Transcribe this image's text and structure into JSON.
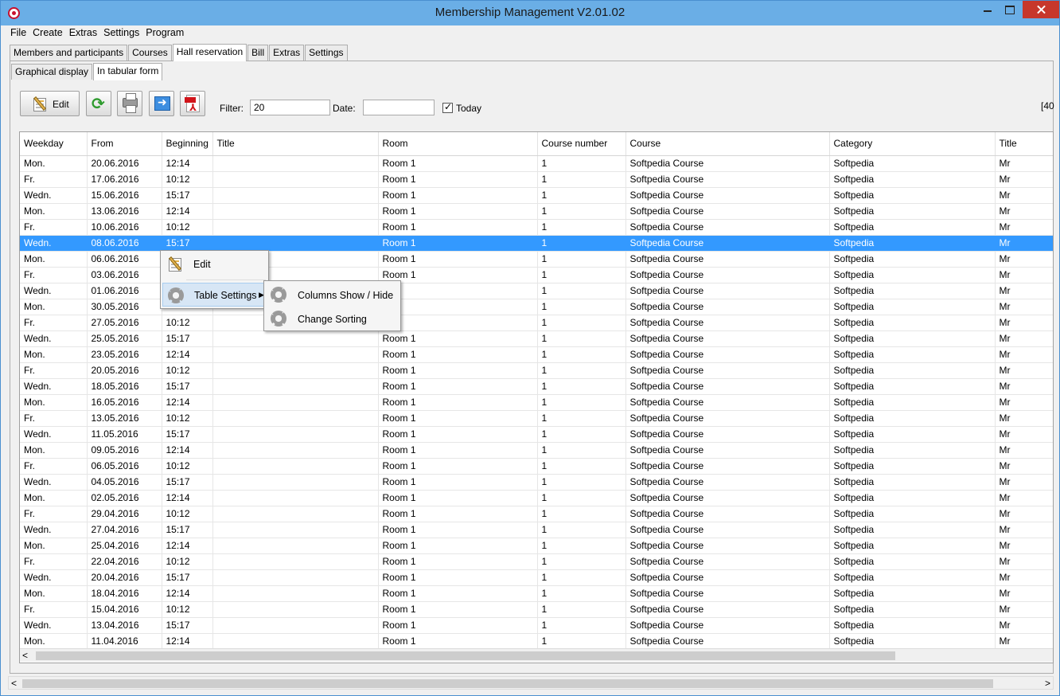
{
  "window": {
    "title": "Membership Management V2.01.02"
  },
  "menu": [
    "File",
    "Create",
    "Extras",
    "Settings",
    "Program"
  ],
  "main_tabs": [
    "Members and participants",
    "Courses",
    "Hall reservation",
    "Bill",
    "Extras",
    "Settings"
  ],
  "main_tabs_active": "Hall reservation",
  "sub_tabs": [
    "Graphical display",
    "In tabular form"
  ],
  "sub_tabs_active": "In tabular form",
  "toolbar": {
    "edit_label": "Edit",
    "filter_label": "Filter:",
    "filter_value": "20",
    "date_label": "Date:",
    "date_value": "",
    "today_label": "Today",
    "today_checked": true,
    "count_text": "[40"
  },
  "icons": [
    "edit-icon",
    "refresh-icon",
    "print-icon",
    "export-icon",
    "pdf-icon"
  ],
  "table": {
    "columns": [
      "Weekday",
      "From",
      "Beginning",
      "Title",
      "Room",
      "Course number",
      "Course",
      "Category",
      "Title"
    ],
    "selected_row": 5,
    "rows": [
      [
        "Mon.",
        "20.06.2016",
        "12:14",
        "",
        "Room 1",
        "1",
        "Softpedia Course",
        "Softpedia",
        "Mr"
      ],
      [
        "Fr.",
        "17.06.2016",
        "10:12",
        "",
        "Room 1",
        "1",
        "Softpedia Course",
        "Softpedia",
        "Mr"
      ],
      [
        "Wedn.",
        "15.06.2016",
        "15:17",
        "",
        "Room 1",
        "1",
        "Softpedia Course",
        "Softpedia",
        "Mr"
      ],
      [
        "Mon.",
        "13.06.2016",
        "12:14",
        "",
        "Room 1",
        "1",
        "Softpedia Course",
        "Softpedia",
        "Mr"
      ],
      [
        "Fr.",
        "10.06.2016",
        "10:12",
        "",
        "Room 1",
        "1",
        "Softpedia Course",
        "Softpedia",
        "Mr"
      ],
      [
        "Wedn.",
        "08.06.2016",
        "15:17",
        "",
        "Room 1",
        "1",
        "Softpedia Course",
        "Softpedia",
        "Mr"
      ],
      [
        "Mon.",
        "06.06.2016",
        "",
        "",
        "Room 1",
        "1",
        "Softpedia Course",
        "Softpedia",
        "Mr"
      ],
      [
        "Fr.",
        "03.06.2016",
        "",
        "",
        "Room 1",
        "1",
        "Softpedia Course",
        "Softpedia",
        "Mr"
      ],
      [
        "Wedn.",
        "01.06.2016",
        "",
        "",
        "",
        "1",
        "Softpedia Course",
        "Softpedia",
        "Mr"
      ],
      [
        "Mon.",
        "30.05.2016",
        "",
        "",
        "",
        "1",
        "Softpedia Course",
        "Softpedia",
        "Mr"
      ],
      [
        "Fr.",
        "27.05.2016",
        "10:12",
        "",
        "",
        "1",
        "Softpedia Course",
        "Softpedia",
        "Mr"
      ],
      [
        "Wedn.",
        "25.05.2016",
        "15:17",
        "",
        "Room 1",
        "1",
        "Softpedia Course",
        "Softpedia",
        "Mr"
      ],
      [
        "Mon.",
        "23.05.2016",
        "12:14",
        "",
        "Room 1",
        "1",
        "Softpedia Course",
        "Softpedia",
        "Mr"
      ],
      [
        "Fr.",
        "20.05.2016",
        "10:12",
        "",
        "Room 1",
        "1",
        "Softpedia Course",
        "Softpedia",
        "Mr"
      ],
      [
        "Wedn.",
        "18.05.2016",
        "15:17",
        "",
        "Room 1",
        "1",
        "Softpedia Course",
        "Softpedia",
        "Mr"
      ],
      [
        "Mon.",
        "16.05.2016",
        "12:14",
        "",
        "Room 1",
        "1",
        "Softpedia Course",
        "Softpedia",
        "Mr"
      ],
      [
        "Fr.",
        "13.05.2016",
        "10:12",
        "",
        "Room 1",
        "1",
        "Softpedia Course",
        "Softpedia",
        "Mr"
      ],
      [
        "Wedn.",
        "11.05.2016",
        "15:17",
        "",
        "Room 1",
        "1",
        "Softpedia Course",
        "Softpedia",
        "Mr"
      ],
      [
        "Mon.",
        "09.05.2016",
        "12:14",
        "",
        "Room 1",
        "1",
        "Softpedia Course",
        "Softpedia",
        "Mr"
      ],
      [
        "Fr.",
        "06.05.2016",
        "10:12",
        "",
        "Room 1",
        "1",
        "Softpedia Course",
        "Softpedia",
        "Mr"
      ],
      [
        "Wedn.",
        "04.05.2016",
        "15:17",
        "",
        "Room 1",
        "1",
        "Softpedia Course",
        "Softpedia",
        "Mr"
      ],
      [
        "Mon.",
        "02.05.2016",
        "12:14",
        "",
        "Room 1",
        "1",
        "Softpedia Course",
        "Softpedia",
        "Mr"
      ],
      [
        "Fr.",
        "29.04.2016",
        "10:12",
        "",
        "Room 1",
        "1",
        "Softpedia Course",
        "Softpedia",
        "Mr"
      ],
      [
        "Wedn.",
        "27.04.2016",
        "15:17",
        "",
        "Room 1",
        "1",
        "Softpedia Course",
        "Softpedia",
        "Mr"
      ],
      [
        "Mon.",
        "25.04.2016",
        "12:14",
        "",
        "Room 1",
        "1",
        "Softpedia Course",
        "Softpedia",
        "Mr"
      ],
      [
        "Fr.",
        "22.04.2016",
        "10:12",
        "",
        "Room 1",
        "1",
        "Softpedia Course",
        "Softpedia",
        "Mr"
      ],
      [
        "Wedn.",
        "20.04.2016",
        "15:17",
        "",
        "Room 1",
        "1",
        "Softpedia Course",
        "Softpedia",
        "Mr"
      ],
      [
        "Mon.",
        "18.04.2016",
        "12:14",
        "",
        "Room 1",
        "1",
        "Softpedia Course",
        "Softpedia",
        "Mr"
      ],
      [
        "Fr.",
        "15.04.2016",
        "10:12",
        "",
        "Room 1",
        "1",
        "Softpedia Course",
        "Softpedia",
        "Mr"
      ],
      [
        "Wedn.",
        "13.04.2016",
        "15:17",
        "",
        "Room 1",
        "1",
        "Softpedia Course",
        "Softpedia",
        "Mr"
      ],
      [
        "Mon.",
        "11.04.2016",
        "12:14",
        "",
        "Room 1",
        "1",
        "Softpedia Course",
        "Softpedia",
        "Mr"
      ]
    ]
  },
  "context_menu": {
    "items": [
      "Edit",
      "Table Settings"
    ],
    "submenu": [
      "Columns Show / Hide",
      "Change Sorting"
    ]
  },
  "colors": {
    "selection": "#3399ff",
    "titlebar": "#6aaee6",
    "close": "#c7372b"
  }
}
